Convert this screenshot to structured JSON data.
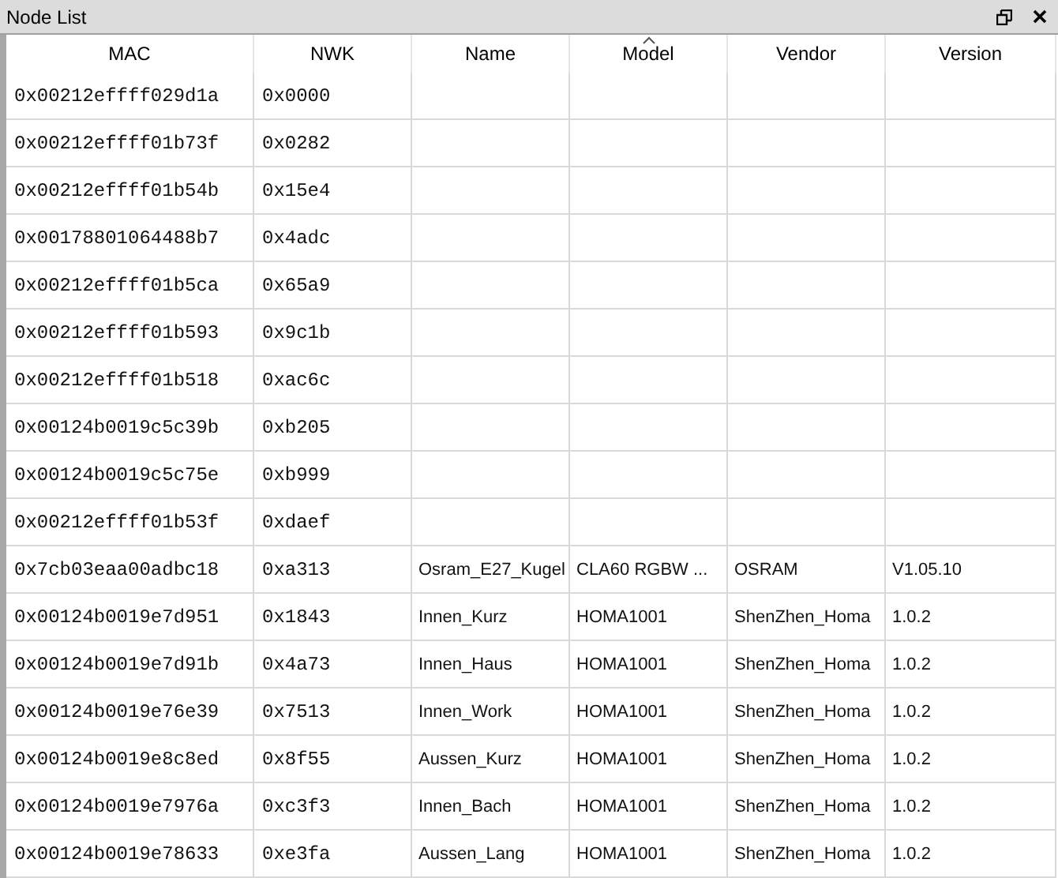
{
  "window": {
    "title": "Node List"
  },
  "table": {
    "columns": [
      {
        "label": "MAC",
        "sorted": false
      },
      {
        "label": "NWK",
        "sorted": false
      },
      {
        "label": "Name",
        "sorted": false
      },
      {
        "label": "Model",
        "sorted": true
      },
      {
        "label": "Vendor",
        "sorted": false
      },
      {
        "label": "Version",
        "sorted": false
      }
    ],
    "rows": [
      [
        "0x00212effff029d1a",
        "0x0000"
      ],
      [
        "0x00212effff01b73f",
        "0x0282"
      ],
      [
        "0x00212effff01b54b",
        "0x15e4"
      ],
      [
        "0x00178801064488b7",
        "0x4adc"
      ],
      [
        "0x00212effff01b5ca",
        "0x65a9"
      ],
      [
        "0x00212effff01b593",
        "0x9c1b"
      ],
      [
        "0x00212effff01b518",
        "0xac6c"
      ],
      [
        "0x00124b0019c5c39b",
        "0xb205"
      ],
      [
        "0x00124b0019c5c75e",
        "0xb999"
      ],
      [
        "0x00212effff01b53f",
        "0xdaef"
      ],
      [
        "0x7cb03eaa00adbc18",
        "0xa313",
        "Osram_E27_Kugel",
        "CLA60 RGBW ...",
        "OSRAM",
        "V1.05.10"
      ],
      [
        "0x00124b0019e7d951",
        "0x1843",
        "Innen_Kurz",
        "HOMA1001",
        "ShenZhen_Homa",
        "1.0.2"
      ],
      [
        "0x00124b0019e7d91b",
        "0x4a73",
        "Innen_Haus",
        "HOMA1001",
        "ShenZhen_Homa",
        "1.0.2"
      ],
      [
        "0x00124b0019e76e39",
        "0x7513",
        "Innen_Work",
        "HOMA1001",
        "ShenZhen_Homa",
        "1.0.2"
      ],
      [
        "0x00124b0019e8c8ed",
        "0x8f55",
        "Aussen_Kurz",
        "HOMA1001",
        "ShenZhen_Homa",
        "1.0.2"
      ],
      [
        "0x00124b0019e7976a",
        "0xc3f3",
        "Innen_Bach",
        "HOMA1001",
        "ShenZhen_Homa",
        "1.0.2"
      ],
      [
        "0x00124b0019e78633",
        "0xe3fa",
        "Aussen_Lang",
        "HOMA1001",
        "ShenZhen_Homa",
        "1.0.2"
      ]
    ]
  }
}
